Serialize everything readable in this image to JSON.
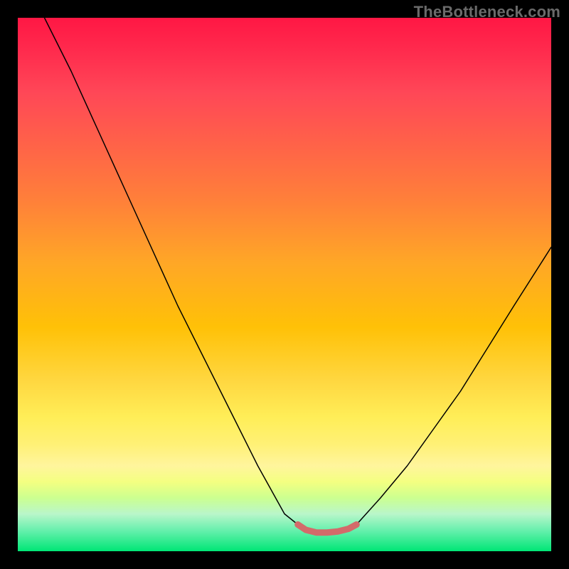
{
  "watermark": {
    "text": "TheBottleneck.com"
  },
  "chart_data": {
    "type": "line",
    "title": "",
    "xlabel": "",
    "ylabel": "",
    "xlim": [
      0,
      100
    ],
    "ylim": [
      0,
      100
    ],
    "background_gradient": {
      "top": "#ff1744",
      "mid": "#ffd740",
      "bottom": "#00e676"
    },
    "series": [
      {
        "name": "left-curve",
        "x": [
          5,
          10,
          15,
          20,
          25,
          30,
          35,
          40,
          45,
          50,
          52.5
        ],
        "y": [
          100,
          90,
          79,
          68,
          57,
          46,
          36,
          26,
          16,
          7,
          5
        ],
        "stroke": "#000000",
        "width": 1.5
      },
      {
        "name": "flat-segment",
        "x": [
          52.5,
          54,
          56,
          58,
          60,
          62,
          63.5
        ],
        "y": [
          5,
          4,
          3.5,
          3.5,
          3.7,
          4.2,
          5
        ],
        "stroke": "#d36a6a",
        "width": 9
      },
      {
        "name": "right-curve",
        "x": [
          63.5,
          68,
          73,
          78,
          83,
          88,
          93,
          100
        ],
        "y": [
          5,
          10,
          16,
          23,
          30,
          38,
          46,
          57
        ],
        "stroke": "#000000",
        "width": 1.5
      }
    ],
    "markers": [
      {
        "x": 52.5,
        "y": 5,
        "r": 4.5,
        "color": "#d36a6a"
      },
      {
        "x": 63.5,
        "y": 5,
        "r": 4.5,
        "color": "#d36a6a"
      }
    ]
  }
}
